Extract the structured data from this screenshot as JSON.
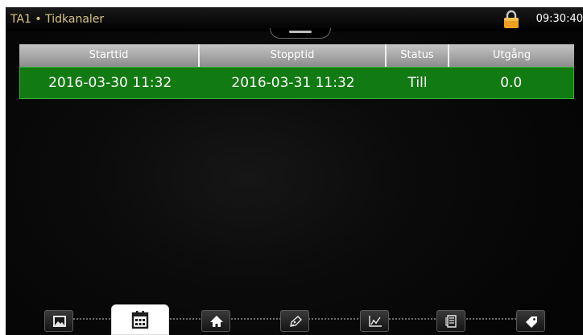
{
  "header": {
    "title": "TA1 • Tidkanaler",
    "time": "09:30:40",
    "lock_icon": "padlock-icon",
    "colors": {
      "title": "#d8c384",
      "lock": "#f0a020"
    }
  },
  "table": {
    "columns": [
      "Starttid",
      "Stopptid",
      "Status",
      "Utgång"
    ],
    "rows": [
      {
        "start": "2016-03-30 11:32",
        "stop": "2016-03-31 11:32",
        "status": "Till",
        "output": "0.0"
      }
    ],
    "colors": {
      "header": "#a8a8a8",
      "row_active": "#127a12"
    }
  },
  "navigation": {
    "active": "calendar",
    "buttons": [
      {
        "name": "image-icon"
      },
      {
        "name": "calendar-icon"
      },
      {
        "name": "home-icon"
      },
      {
        "name": "pen-icon"
      },
      {
        "name": "chart-icon"
      },
      {
        "name": "document-icon"
      },
      {
        "name": "tag-icon"
      }
    ]
  }
}
